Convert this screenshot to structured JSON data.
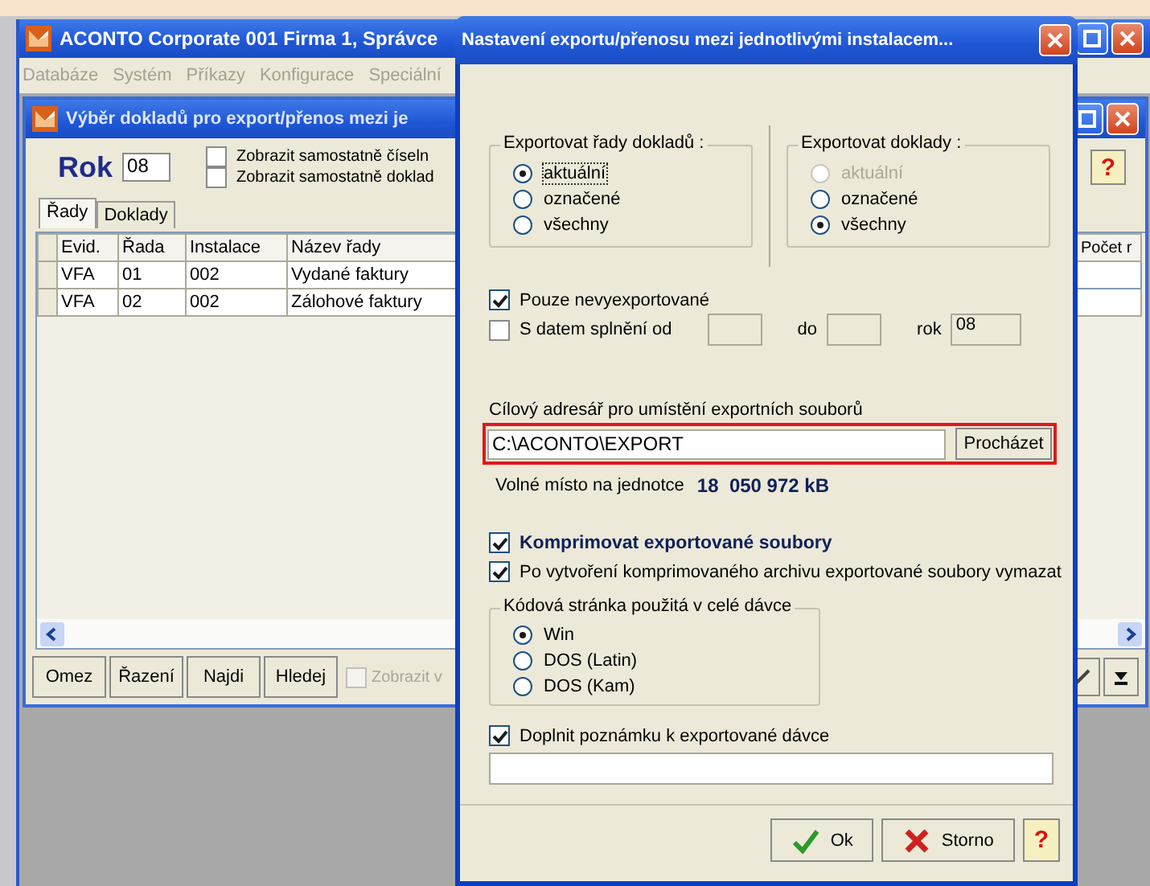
{
  "main_window": {
    "title": "ACONTO Corporate 001 Firma 1, Správce",
    "menu": [
      "Databáze",
      "Systém",
      "Příkazy",
      "Konfigurace",
      "Speciální"
    ]
  },
  "sub_window": {
    "title": "Výběr dokladů pro export/přenos mezi je",
    "year_label": "Rok",
    "year": "08",
    "help": "?",
    "options": [
      {
        "label": "Zobrazit samostatně číseln",
        "checked": false
      },
      {
        "label": "Zobrazit samostatně doklad",
        "checked": false
      }
    ],
    "tabs": [
      {
        "label": "Řady",
        "selected": true
      },
      {
        "label": "Doklady",
        "selected": false
      }
    ],
    "table": {
      "columns": [
        "Evid.",
        "Řada",
        "Instalace",
        "Název řady",
        "Počet r"
      ],
      "rows": [
        [
          "VFA",
          "01",
          "002",
          "Vydané faktury"
        ],
        [
          "VFA",
          "02",
          "002",
          "Zálohové faktury"
        ]
      ]
    },
    "toolbar": [
      "Omez",
      "Řazení",
      "Najdi",
      "Hledej"
    ],
    "toolbar_option": {
      "label": "Zobrazit v",
      "checked": false,
      "disabled": true
    }
  },
  "dialog": {
    "title": "Nastavení exportu/přenosu mezi jednotlivými instalacem...",
    "groups": [
      {
        "title": "Exportovat řady dokladů :",
        "options": [
          {
            "label": "aktuální",
            "selected": true,
            "disabled": false
          },
          {
            "label": "označené",
            "selected": false,
            "disabled": false
          },
          {
            "label": "všechny",
            "selected": false,
            "disabled": false
          }
        ]
      },
      {
        "title": "Exportovat doklady :",
        "options": [
          {
            "label": "aktuální",
            "selected": false,
            "disabled": true
          },
          {
            "label": "označené",
            "selected": false,
            "disabled": false
          },
          {
            "label": "všechny",
            "selected": true,
            "disabled": false
          }
        ]
      }
    ],
    "only_new": {
      "label": "Pouze nevyexportované",
      "checked": true
    },
    "date_filter": {
      "label": "S datem splnění od",
      "checked": false,
      "to_label": "do",
      "year_label": "rok",
      "year": "08"
    },
    "target_label": "Cílový adresář pro umístění exportních souborů",
    "target_path": "C:\\ACONTO\\EXPORT",
    "browse": "Procházet",
    "target_highlighted": true,
    "free_space_label": "Volné místo na jednotce",
    "free_space": "18  050 972 kB",
    "compress": {
      "label": "Komprimovat exportované soubory",
      "checked": true
    },
    "delete_after": {
      "label": "Po vytvoření komprimovaného archivu exportované soubory vymazat",
      "checked": true
    },
    "codepage": {
      "title": "Kódová stránka použitá v celé dávce",
      "options": [
        {
          "label": "Win",
          "selected": true,
          "disabled": false
        },
        {
          "label": "DOS (Latin)",
          "selected": false,
          "disabled": false
        },
        {
          "label": "DOS (Kam)",
          "selected": false,
          "disabled": false
        }
      ]
    },
    "note": {
      "label": "Doplnit poznámku k exportované dávce",
      "checked": true
    },
    "buttons": [
      {
        "kind": "ok",
        "label": "Ok"
      },
      {
        "kind": "cancel",
        "label": "Storno"
      },
      {
        "kind": "help",
        "label": "?"
      }
    ]
  }
}
